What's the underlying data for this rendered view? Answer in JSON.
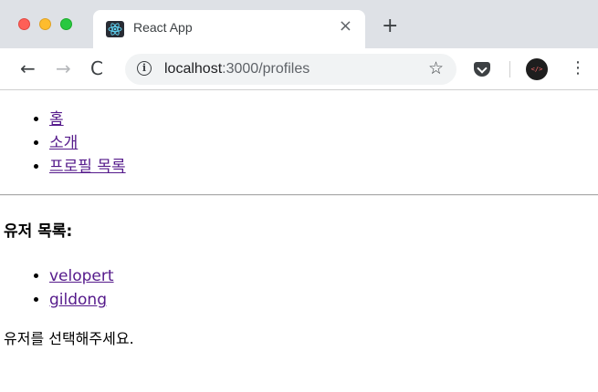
{
  "browser": {
    "tab_title": "React App",
    "tab_close": "×",
    "new_tab": "+",
    "url_host": "localhost",
    "url_path": ":3000/profiles",
    "back": "←",
    "forward": "→",
    "reload": "C",
    "info": "i",
    "star": "☆",
    "menu": "⋮",
    "extension_label": "</>"
  },
  "colors": {
    "link_visited": "#551a8b",
    "tabbar_bg": "#dee1e6"
  },
  "nav": {
    "items": [
      {
        "label": "홈"
      },
      {
        "label": "소개"
      },
      {
        "label": "프로필 목록"
      }
    ]
  },
  "main": {
    "heading": "유저 목록:",
    "users": [
      {
        "label": "velopert"
      },
      {
        "label": "gildong"
      }
    ],
    "hint": "유저를 선택해주세요."
  }
}
